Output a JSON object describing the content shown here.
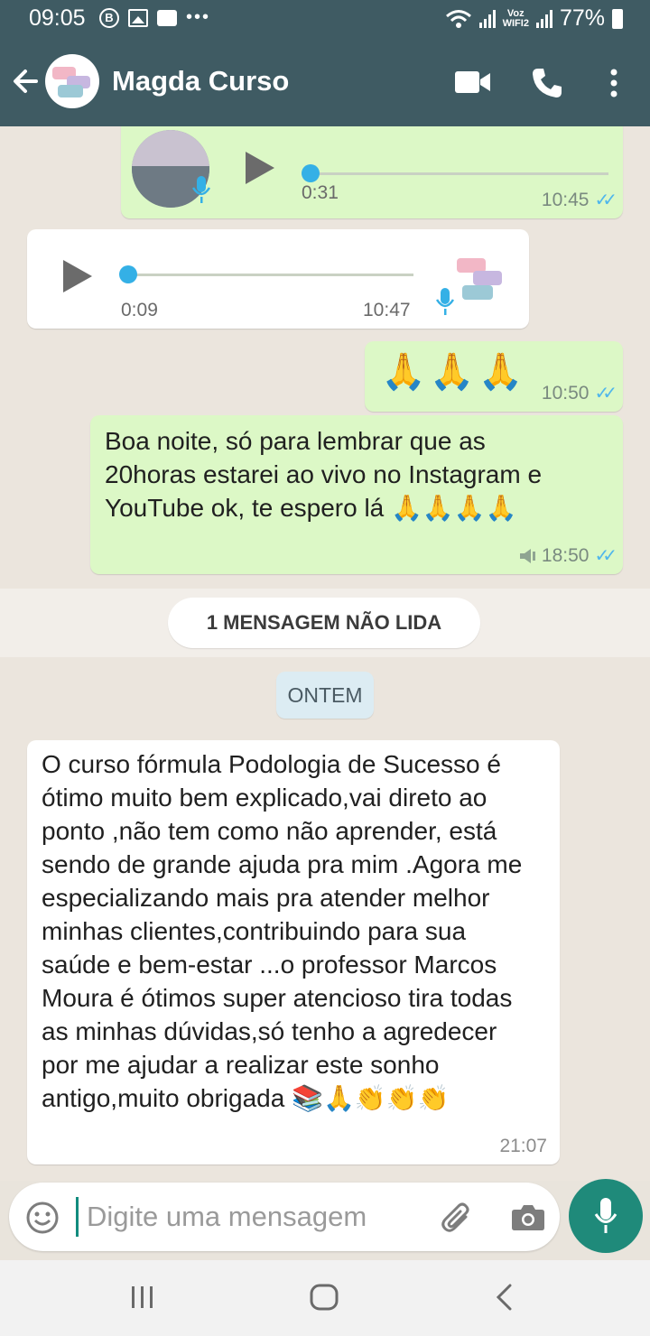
{
  "status_bar": {
    "time": "09:05",
    "badge_b": "B",
    "voz_line1": "Voz",
    "voz_line2": "WIFI2",
    "battery": "77%"
  },
  "header": {
    "contact_name": "Magda Curso",
    "icons": [
      "back-arrow-icon",
      "video-call-icon",
      "phone-icon",
      "more-options-icon"
    ]
  },
  "messages": [
    {
      "type": "audio",
      "direction": "out",
      "duration": "0:31",
      "time": "10:45",
      "progress": 0
    },
    {
      "type": "audio",
      "direction": "in",
      "duration": "0:09",
      "time": "10:47",
      "progress": 0
    },
    {
      "type": "emoji",
      "direction": "out",
      "text": "🙏🙏🙏",
      "time": "10:50"
    },
    {
      "type": "text",
      "direction": "out",
      "lines": [
        "Boa noite,  só para lembrar que as",
        "20horas estarei ao vivo no Instagram e",
        "YouTube ok, te espero lá 🙏🙏🙏🙏"
      ],
      "time": "18:50"
    },
    {
      "type": "text",
      "direction": "in",
      "lines": [
        "O curso fórmula Podologia de Sucesso é",
        "ótimo muito bem explicado,vai direto ao",
        "ponto ,não tem como não aprender, está",
        "sendo de grande ajuda pra mim .Agora me",
        "especializando mais pra atender melhor",
        "minhas clientes,contribuindo para sua",
        "saúde e bem-estar ...o professor Marcos",
        "Moura é ótimos super atencioso tira todas",
        "as minhas dúvidas,só tenho a agredecer",
        "por me ajudar a realizar este sonho",
        "antigo,muito obrigada 📚🙏👏👏👏"
      ],
      "time": "21:07"
    }
  ],
  "unread_label": "1 MENSAGEM NÃO LIDA",
  "date_label": "ONTEM",
  "composer": {
    "placeholder": "Digite uma mensagem"
  },
  "colors": {
    "header_bg": "#3f5b63",
    "outgoing_bubble": "#dcf8c6",
    "incoming_bubble": "#ffffff",
    "read_ticks": "#4fb6ec",
    "mic_button": "#1f8a7a"
  }
}
